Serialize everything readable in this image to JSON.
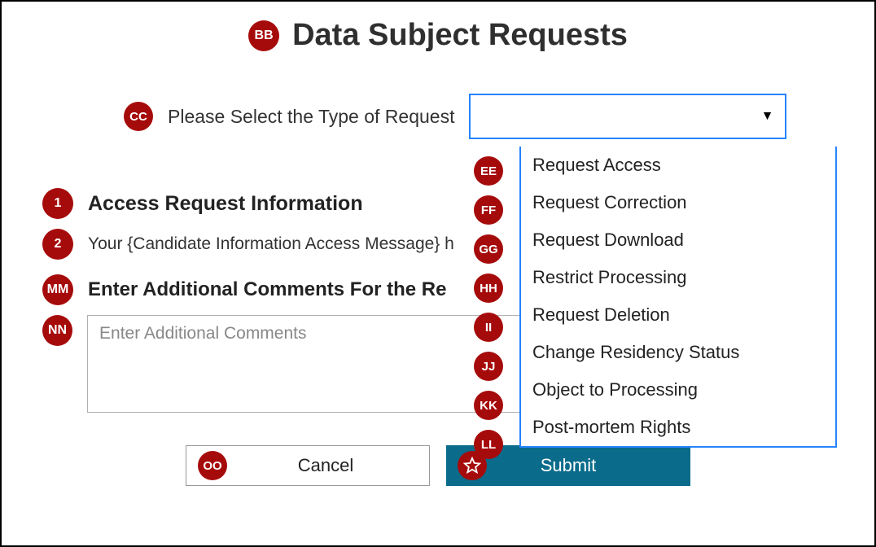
{
  "title": "Data Subject Requests",
  "select": {
    "label": "Please Select the Type of Request",
    "placeholder": "",
    "options": [
      "Request Access",
      "Request Correction",
      "Request Download",
      "Restrict Processing",
      "Request Deletion",
      "Change Residency Status",
      "Object to Processing",
      "Post-mortem Rights"
    ]
  },
  "section": {
    "heading": "Access Request Information",
    "sub": "Your {Candidate Information Access Message} h",
    "comments_label": "Enter Additional Comments For the Re",
    "comments_placeholder": "Enter Additional Comments"
  },
  "buttons": {
    "cancel": "Cancel",
    "submit": "Submit"
  },
  "badges": {
    "title": "BB",
    "select_label": "CC",
    "left": [
      "1",
      "2",
      "MM",
      "NN"
    ],
    "dropdown": [
      "EE",
      "FF",
      "GG",
      "HH",
      "II",
      "JJ",
      "KK",
      "LL"
    ],
    "cancel": "OO"
  }
}
